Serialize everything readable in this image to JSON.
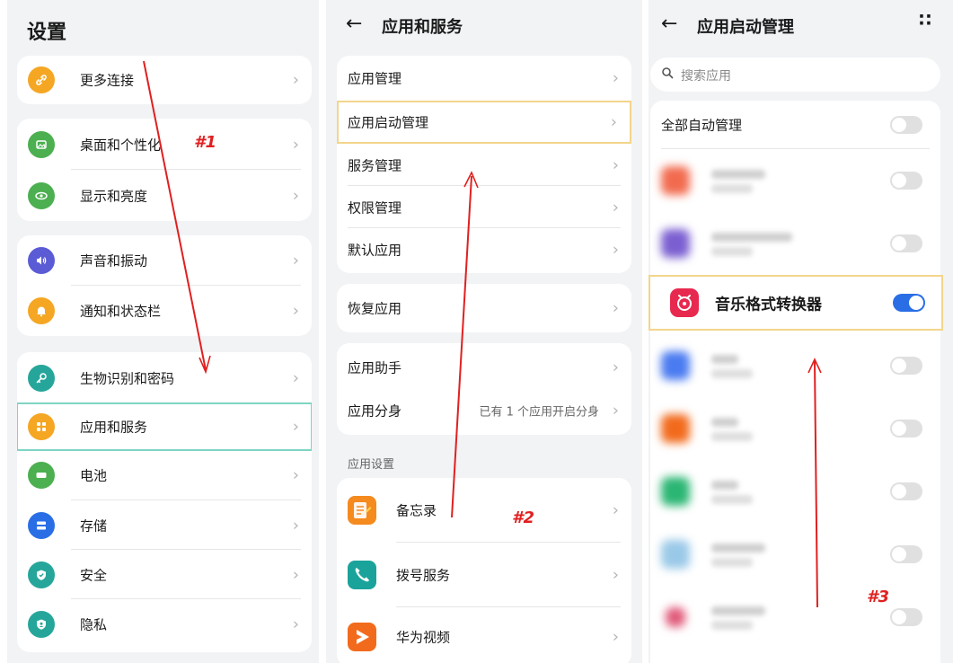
{
  "panel1": {
    "title": "设置",
    "groups": [
      {
        "items": [
          {
            "label": "更多连接",
            "icon": "link-icon",
            "color": "#f5a623"
          }
        ]
      },
      {
        "items": [
          {
            "label": "桌面和个性化",
            "icon": "image-icon",
            "color": "#4caf50"
          },
          {
            "label": "显示和亮度",
            "icon": "eye-icon",
            "color": "#4caf50"
          }
        ]
      },
      {
        "items": [
          {
            "label": "声音和振动",
            "icon": "speaker-icon",
            "color": "#5b5bd6"
          },
          {
            "label": "通知和状态栏",
            "icon": "bell-icon",
            "color": "#f5a623"
          }
        ]
      },
      {
        "items": [
          {
            "label": "生物识别和密码",
            "icon": "key-icon",
            "color": "#26a69a"
          },
          {
            "label": "应用和服务",
            "icon": "apps-icon",
            "color": "#f5a623"
          },
          {
            "label": "电池",
            "icon": "battery-icon",
            "color": "#4caf50"
          },
          {
            "label": "存储",
            "icon": "storage-icon",
            "color": "#2a6ee6"
          },
          {
            "label": "安全",
            "icon": "shield-icon",
            "color": "#26a69a"
          },
          {
            "label": "隐私",
            "icon": "privacy-icon",
            "color": "#26a69a"
          }
        ]
      }
    ]
  },
  "panel2": {
    "title": "应用和服务",
    "group1": [
      "应用管理",
      "应用启动管理",
      "服务管理",
      "权限管理",
      "默认应用"
    ],
    "group2": [
      "恢复应用"
    ],
    "group3": [
      {
        "label": "应用助手",
        "value": ""
      },
      {
        "label": "应用分身",
        "value": "已有 1 个应用开启分身"
      }
    ],
    "section_title": "应用设置",
    "apps": [
      {
        "label": "备忘录",
        "icon": "memo-icon",
        "color": "#f58a1f"
      },
      {
        "label": "拨号服务",
        "icon": "phone-icon",
        "color": "#1aa39a"
      },
      {
        "label": "华为视频",
        "icon": "video-icon",
        "color": "#f26b1d"
      }
    ]
  },
  "panel3": {
    "title": "应用启动管理",
    "search_placeholder": "搜索应用",
    "all_label": "全部自动管理",
    "highlight_app": "音乐格式转换器",
    "blurred_colors": [
      "#f26b4f",
      "#7b5fd1",
      "#4a7bf0",
      "#f26b1d",
      "#2bb673",
      "#9ac9e8",
      "#e05a7a"
    ]
  },
  "annotations": {
    "a1": "#1",
    "a2": "#2",
    "a3": "#3"
  }
}
